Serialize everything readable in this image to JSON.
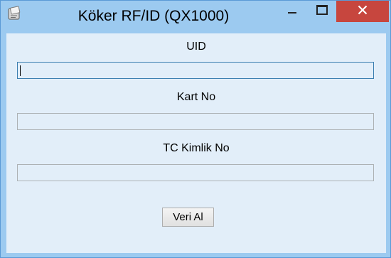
{
  "window": {
    "title": "Köker RF/ID (QX1000)",
    "icon": "app-card-reader-icon",
    "controls": {
      "minimize_icon": "minimize-icon",
      "maximize_icon": "maximize-icon",
      "close_icon": "close-icon"
    },
    "colors": {
      "frame": "#9ccaf0",
      "client": "#e2eef9",
      "close_button": "#c7463e"
    }
  },
  "form": {
    "uid": {
      "label": "UID",
      "value": "",
      "focused": true
    },
    "card_no": {
      "label": "Kart No",
      "value": ""
    },
    "tc_id_no": {
      "label": "TC Kimlik No",
      "value": ""
    },
    "fetch_button_label": "Veri Al"
  }
}
